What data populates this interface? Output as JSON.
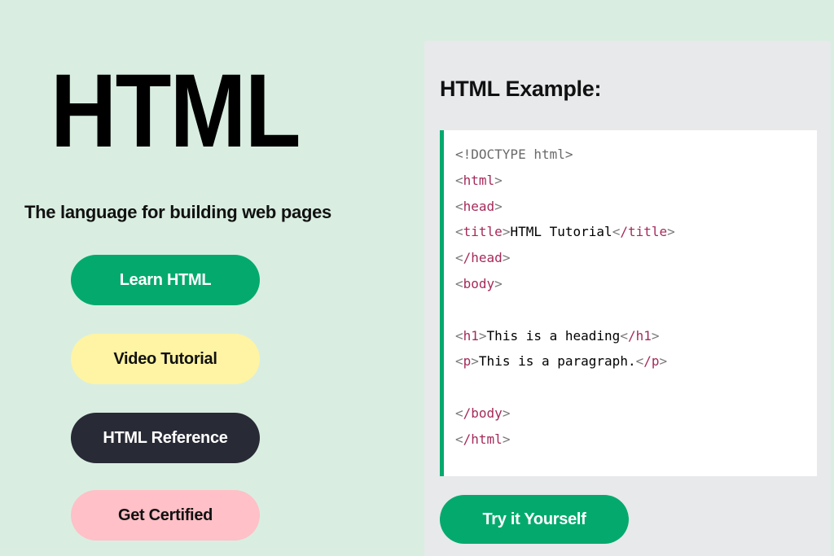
{
  "hero": {
    "title": "HTML",
    "tagline": "The language for building web pages"
  },
  "buttons": {
    "learn": "Learn HTML",
    "video": "Video Tutorial",
    "reference": "HTML Reference",
    "certified": "Get Certified"
  },
  "example": {
    "title": "HTML Example:",
    "try_label": "Try it Yourself",
    "code": {
      "doctype": "<!DOCTYPE html>",
      "html_open_tag": "html",
      "head_open_tag": "head",
      "title_open_tag": "title",
      "title_text": "HTML Tutorial",
      "title_close_tag": "/title",
      "head_close_tag": "/head",
      "body_open_tag": "body",
      "h1_open_tag": "h1",
      "h1_text": "This is a heading",
      "h1_close_tag": "/h1",
      "p_open_tag": "p",
      "p_text": "This is a paragraph.",
      "p_close_tag": "/p",
      "body_close_tag": "/body",
      "html_close_tag": "/html"
    }
  },
  "colors": {
    "page_background": "#d9eee1",
    "brand_green": "#04aa6d",
    "video_yellow": "#fff4a3",
    "reference_dark": "#282a35",
    "certified_pink": "#ffc0c7",
    "panel_gray": "#e7e9eb",
    "tag_color": "#a52a5a"
  }
}
